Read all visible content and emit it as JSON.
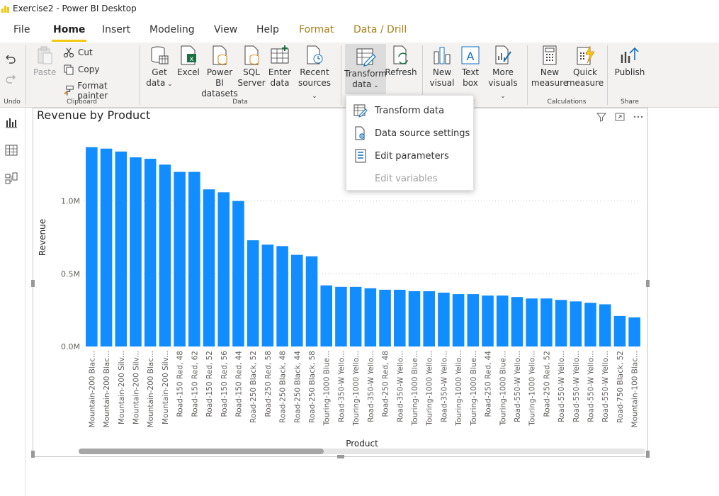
{
  "window": {
    "title": "Exercise2 - Power BI Desktop"
  },
  "menu": {
    "tabs": [
      {
        "label": "File"
      },
      {
        "label": "Home"
      },
      {
        "label": "Insert"
      },
      {
        "label": "Modeling"
      },
      {
        "label": "View"
      },
      {
        "label": "Help"
      },
      {
        "label": "Format"
      },
      {
        "label": "Data / Drill"
      }
    ],
    "active": "Home"
  },
  "ribbon": {
    "undo": {
      "group_label": "Undo"
    },
    "clipboard": {
      "paste": "Paste",
      "cut": "Cut",
      "copy": "Copy",
      "format_painter": "Format painter",
      "group_label": "Clipboard"
    },
    "data": {
      "get_data": [
        "Get",
        "data"
      ],
      "excel": "Excel",
      "pbi_datasets": [
        "Power BI",
        "datasets"
      ],
      "sql_server": [
        "SQL",
        "Server"
      ],
      "enter_data": [
        "Enter",
        "data"
      ],
      "recent_sources": [
        "Recent",
        "sources"
      ],
      "group_label": "Data"
    },
    "queries": {
      "transform_data": [
        "Transform",
        "data"
      ],
      "refresh": "Refresh"
    },
    "insert": {
      "new_visual": [
        "New",
        "visual"
      ],
      "text_box": [
        "Text",
        "box"
      ],
      "more_visuals": [
        "More",
        "visuals"
      ],
      "group_label_fragment": "ert"
    },
    "calculations": {
      "new_measure": [
        "New",
        "measure"
      ],
      "quick_measure": [
        "Quick",
        "measure"
      ],
      "group_label": "Calculations"
    },
    "share": {
      "publish": "Publish",
      "group_label": "Share"
    }
  },
  "dropdown": {
    "items": [
      {
        "label": "Transform data",
        "enabled": true,
        "icon": "transform-data-icon"
      },
      {
        "label": "Data source settings",
        "enabled": true,
        "icon": "data-source-settings-icon"
      },
      {
        "label": "Edit parameters",
        "enabled": true,
        "icon": "edit-parameters-icon"
      },
      {
        "label": "Edit variables",
        "enabled": false,
        "icon": ""
      }
    ]
  },
  "chart_data": {
    "type": "bar",
    "title": "Revenue by Product",
    "xlabel": "Product",
    "ylabel": "Revenue",
    "y_ticks": [
      "0.0M",
      "0.5M",
      "1.0M"
    ],
    "ylim": [
      0,
      1.5
    ],
    "bar_color": "#118dff",
    "grid": true,
    "categories": [
      "Mountain-200 Blac...",
      "Mountain-200 Blac...",
      "Mountain-200 Silv...",
      "Mountain-200 Silv...",
      "Mountain-200 Blac...",
      "Mountain-200 Silv...",
      "Road-150 Red, 48",
      "Road-150 Red, 62",
      "Road-150 Red, 52",
      "Road-150 Red, 56",
      "Road-150 Red, 44",
      "Road-250 Black, 52",
      "Road-250 Red, 58",
      "Road-250 Black, 48",
      "Road-250 Black, 44",
      "Road-250 Black, 58",
      "Touring-1000 Blue...",
      "Road-350-W Yello...",
      "Touring-1000 Yello...",
      "Road-350-W Yello...",
      "Road-250 Red, 48",
      "Road-350-W Yello...",
      "Touring-1000 Blue...",
      "Touring-1000 Yello...",
      "Road-350-W Yello...",
      "Touring-1000 Yello...",
      "Touring-1000 Blue...",
      "Road-250 Red, 44",
      "Touring-1000 Blue...",
      "Road-550-W Yello...",
      "Touring-1000 Yello...",
      "Road-250 Red, 52",
      "Road-550-W Yello...",
      "Road-550-W Yello...",
      "Road-550-W Yello...",
      "Road-550-W Yello...",
      "Road-750 Black, 52",
      "Mountain-100 Blac..."
    ],
    "values": [
      1.37,
      1.36,
      1.34,
      1.3,
      1.29,
      1.25,
      1.2,
      1.2,
      1.08,
      1.06,
      1.0,
      0.73,
      0.7,
      0.69,
      0.63,
      0.62,
      0.42,
      0.41,
      0.41,
      0.4,
      0.39,
      0.39,
      0.38,
      0.38,
      0.37,
      0.36,
      0.36,
      0.35,
      0.35,
      0.34,
      0.33,
      0.33,
      0.32,
      0.31,
      0.3,
      0.29,
      0.21,
      0.2
    ]
  }
}
